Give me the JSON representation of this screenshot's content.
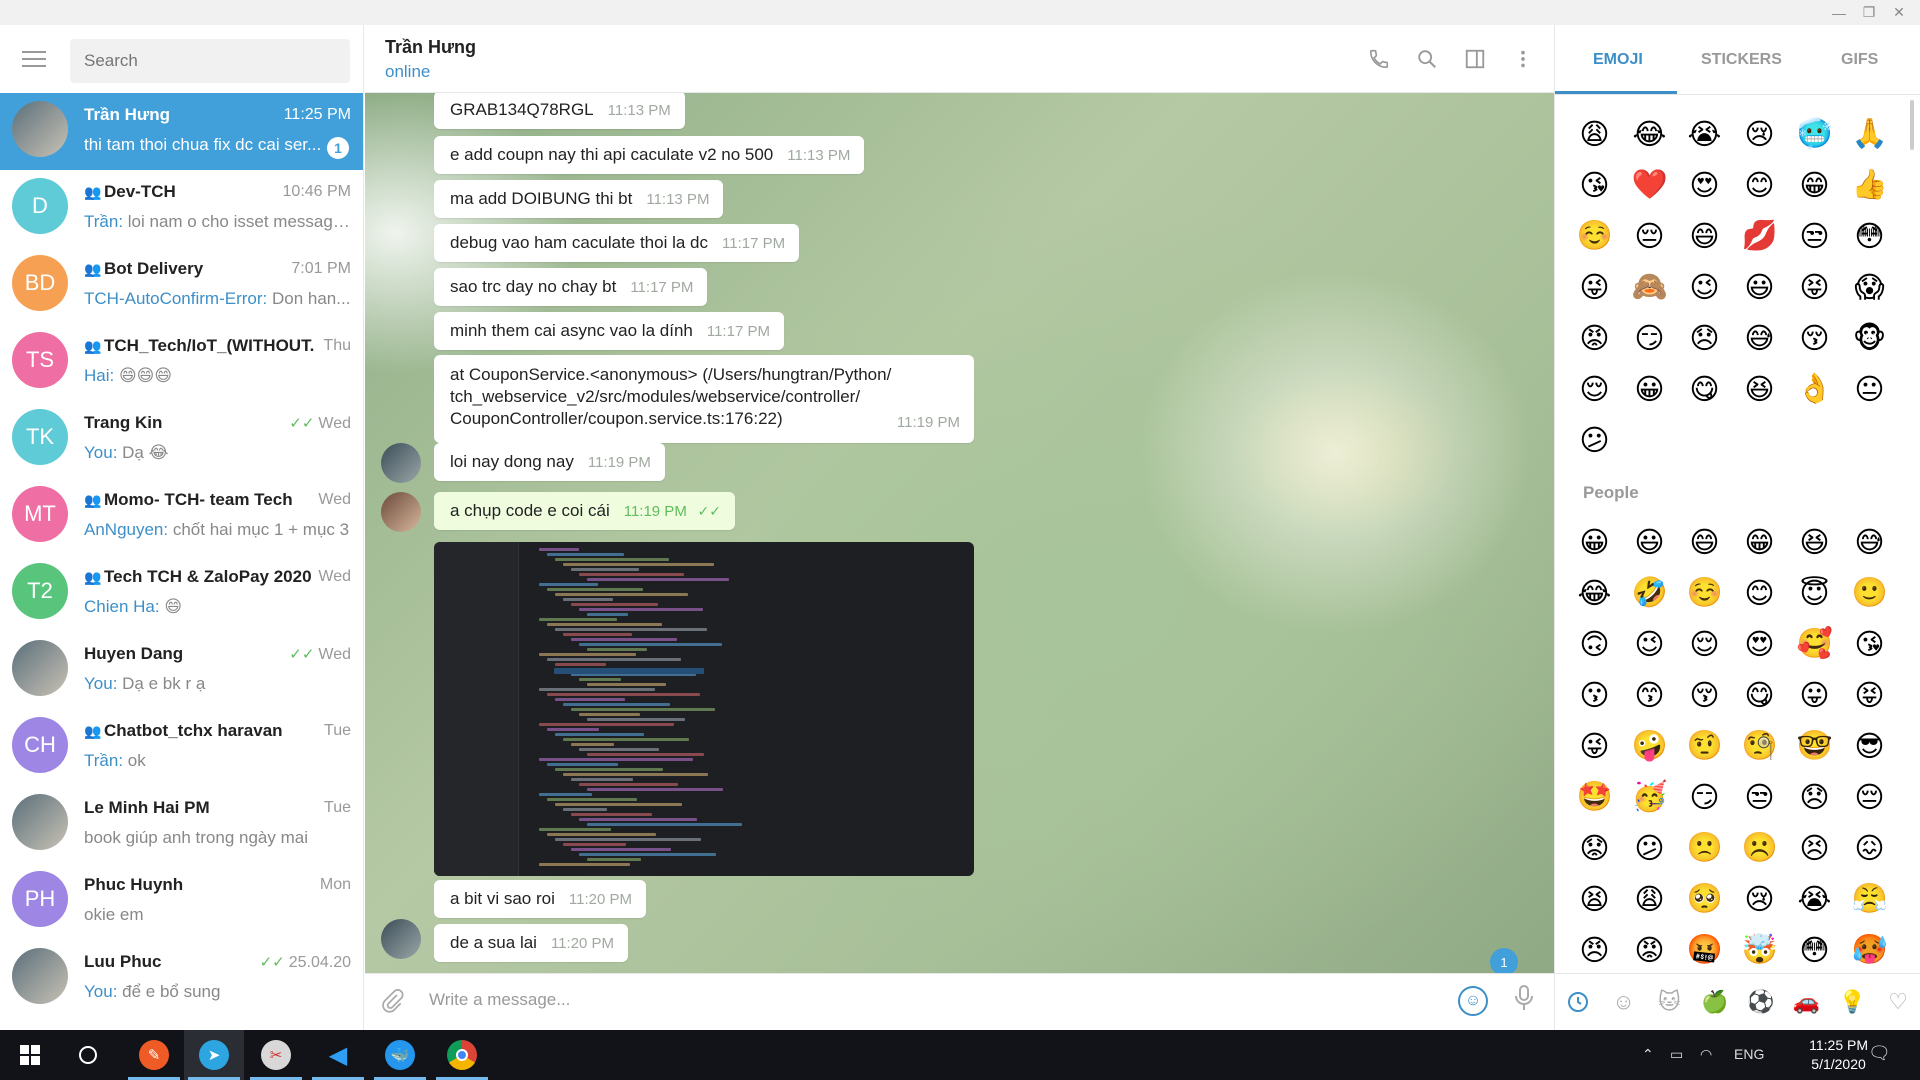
{
  "window": {
    "controls": [
      "minimize",
      "restore",
      "close"
    ]
  },
  "sidebar": {
    "search_placeholder": "Search",
    "chats": [
      {
        "name": "Trần Hưng",
        "time": "11:25 PM",
        "sender": "",
        "message": "thi tam thoi chua fix dc cai ser...",
        "badge": "1",
        "active": true,
        "group": false,
        "avatar_text": "",
        "avatar_color": "",
        "tick": ""
      },
      {
        "name": "Dev-TCH",
        "time": "10:46 PM",
        "sender": "Trần:",
        "message": " loi nam o cho isset message...",
        "group": true,
        "avatar_text": "D",
        "avatar_color": "#5ecbd6",
        "tick": ""
      },
      {
        "name": "Bot Delivery",
        "time": "7:01 PM",
        "sender": "TCH-AutoConfirm-Error:",
        "message": " Don han...",
        "group": true,
        "avatar_text": "BD",
        "avatar_color": "#f6a054",
        "tick": ""
      },
      {
        "name": "TCH_Tech/IoT_(WITHOUT...",
        "time": "Thu",
        "sender": "Hai:",
        "message": " 😄😄😄",
        "group": true,
        "avatar_text": "TS",
        "avatar_color": "#ef6ea3",
        "tick": ""
      },
      {
        "name": "Trang Kin",
        "time": "Wed",
        "sender": "You:",
        "message": " Dạ 😂",
        "group": false,
        "avatar_text": "TK",
        "avatar_color": "#5ecbd6",
        "tick": "✓✓"
      },
      {
        "name": "Momo- TCH- team Tech",
        "time": "Wed",
        "sender": "AnNguyen:",
        "message": " chốt hai mục 1 + mục 3",
        "group": true,
        "avatar_text": "MT",
        "avatar_color": "#ef6ea3",
        "tick": ""
      },
      {
        "name": "Tech TCH & ZaloPay 2020",
        "time": "Wed",
        "sender": "Chien Ha:",
        "message": " 😄",
        "group": true,
        "avatar_text": "T2",
        "avatar_color": "#58c47c",
        "tick": ""
      },
      {
        "name": "Huyen Dang",
        "time": "Wed",
        "sender": "You:",
        "message": " Dạ e bk r ạ",
        "group": false,
        "avatar_text": "",
        "avatar_color": "",
        "tick": "✓✓"
      },
      {
        "name": "Chatbot_tchx haravan",
        "time": "Tue",
        "sender": "Trần:",
        "message": " ok",
        "group": true,
        "avatar_text": "CH",
        "avatar_color": "#9e86e4",
        "tick": ""
      },
      {
        "name": "Le Minh Hai PM",
        "time": "Tue",
        "sender": "",
        "message": "book giúp anh trong ngày mai",
        "group": false,
        "avatar_text": "",
        "avatar_color": "",
        "tick": ""
      },
      {
        "name": "Phuc Huynh",
        "time": "Mon",
        "sender": "",
        "message": "okie em",
        "group": false,
        "avatar_text": "PH",
        "avatar_color": "#9e86e4",
        "tick": ""
      },
      {
        "name": "Luu Phuc",
        "time": "25.04.20",
        "sender": "You:",
        "message": " để e bổ sung",
        "group": false,
        "avatar_text": "",
        "avatar_color": "",
        "tick": "✓✓"
      }
    ]
  },
  "header": {
    "name": "Trần Hưng",
    "status": "online"
  },
  "messages": [
    {
      "text": "GRAB134Q78RGL",
      "time": "11:13 PM"
    },
    {
      "text": "e add coupn nay thi api caculate v2 no 500",
      "time": "11:13 PM"
    },
    {
      "text": "ma add DOIBUNG thi bt",
      "time": "11:13 PM"
    },
    {
      "text": "debug vao ham caculate thoi la dc",
      "time": "11:17 PM"
    },
    {
      "text": "sao trc day no chay bt",
      "time": "11:17 PM"
    },
    {
      "text": "minh them cai async vao la dính",
      "time": "11:17 PM"
    },
    {
      "text_lines": [
        "at CouponService.<anonymous> (/Users/hungtran/Python/",
        "tch_webservice_v2/src/modules/webservice/controller/",
        "CouponController/coupon.service.ts:176:22)"
      ],
      "time": "11:19 PM"
    },
    {
      "text": "loi nay dong nay",
      "time": "11:19 PM"
    },
    {
      "text": "a chụp code e coi cái",
      "time": "11:19 PM",
      "outgoing": true,
      "tick": "✓✓"
    },
    {
      "text": "a bit vi sao roi",
      "time": "11:20 PM"
    },
    {
      "text": "de a sua lai",
      "time": "11:20 PM"
    }
  ],
  "scroll_badge": "1",
  "composer": {
    "placeholder": "Write a message..."
  },
  "emoji_panel": {
    "tabs": [
      "EMOJI",
      "STICKERS",
      "GIFS"
    ],
    "recent": [
      "😩",
      "😂",
      "😭",
      "😢",
      "🥶",
      "🙏",
      "😘",
      "❤️",
      "😍",
      "😊",
      "😁",
      "👍",
      "☺️",
      "😔",
      "😄",
      "💋",
      "😒",
      "😳",
      "😜",
      "🙈",
      "😉",
      "😃",
      "😝",
      "😱",
      "😡",
      "😏",
      "😞",
      "😅",
      "😚",
      "🐵",
      "😌",
      "😀",
      "😋",
      "😆",
      "👌",
      "😐",
      "😕"
    ],
    "section_title": "People",
    "people": [
      "😀",
      "😃",
      "😄",
      "😁",
      "😆",
      "😅",
      "😂",
      "🤣",
      "☺️",
      "😊",
      "😇",
      "🙂",
      "🙃",
      "😉",
      "😌",
      "😍",
      "🥰",
      "😘",
      "😗",
      "😙",
      "😚",
      "😋",
      "😛",
      "😝",
      "😜",
      "🤪",
      "🤨",
      "🧐",
      "🤓",
      "😎",
      "🤩",
      "🥳",
      "😏",
      "😒",
      "😞",
      "😔",
      "😟",
      "😕",
      "🙁",
      "☹️",
      "😣",
      "😖",
      "😫",
      "😩",
      "🥺",
      "😢",
      "😭",
      "😤",
      "😠",
      "😡",
      "🤬",
      "🤯",
      "😳",
      "🥵"
    ],
    "categories": [
      "recent-icon",
      "smile-icon",
      "cat-icon",
      "apple-icon",
      "ball-icon",
      "car-icon",
      "bulb-icon",
      "heart-icon"
    ]
  },
  "taskbar": {
    "lang": "ENG",
    "time": "11:25 PM",
    "date": "5/1/2020"
  },
  "colors": {
    "accent": "#419fd9",
    "link": "#3d8fc7",
    "outgoing_bubble": "#effdde",
    "read_tick": "#5ebd5e"
  }
}
